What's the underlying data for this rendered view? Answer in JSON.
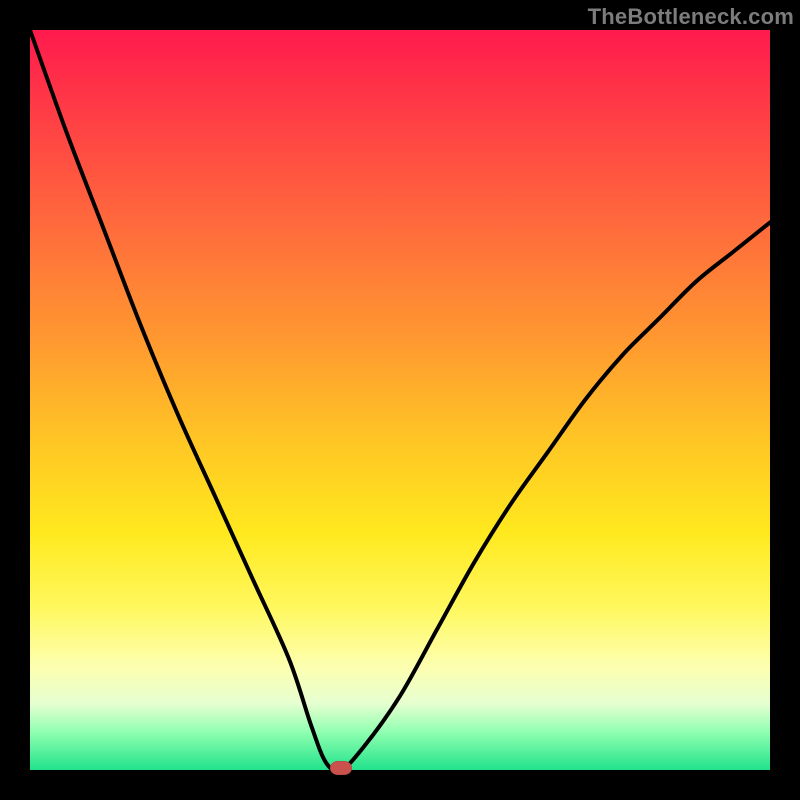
{
  "watermark": "TheBottleneck.com",
  "colors": {
    "frame": "#000000",
    "curve": "#000000",
    "marker": "#c9534c"
  },
  "chart_data": {
    "type": "line",
    "title": "",
    "xlabel": "",
    "ylabel": "",
    "xlim": [
      0,
      100
    ],
    "ylim": [
      0,
      100
    ],
    "grid": false,
    "legend": false,
    "annotations": [],
    "series": [
      {
        "name": "curve",
        "x": [
          0,
          5,
          10,
          15,
          20,
          25,
          30,
          35,
          38,
          40,
          42,
          45,
          50,
          55,
          60,
          65,
          70,
          75,
          80,
          85,
          90,
          95,
          100
        ],
        "y": [
          100,
          86,
          73,
          60,
          48,
          37,
          26,
          15,
          6,
          1,
          0,
          3,
          10,
          19,
          28,
          36,
          43,
          50,
          56,
          61,
          66,
          70,
          74
        ]
      }
    ],
    "marker": {
      "x": 42,
      "y": 0
    }
  }
}
